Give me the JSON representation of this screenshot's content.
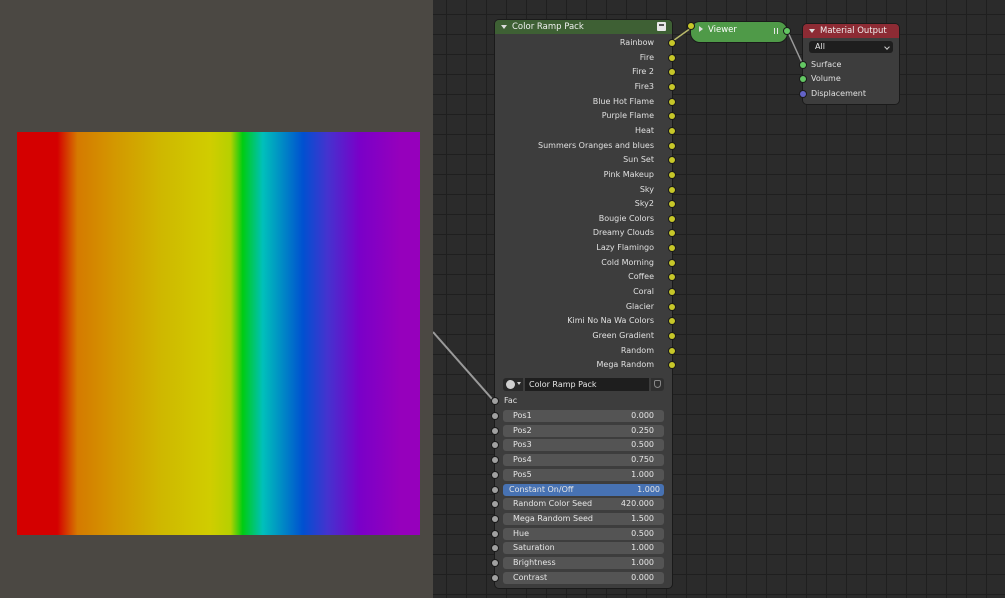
{
  "group_node": {
    "title": "Color Ramp Pack",
    "outputs": [
      "Rainbow",
      "Fire",
      "Fire 2",
      "Fire3",
      "Blue Hot Flame",
      "Purple Flame",
      "Heat",
      "Summers Oranges and blues",
      "Sun Set",
      "Pink Makeup",
      "Sky",
      "Sky2",
      "Bougie Colors",
      "Dreamy Clouds",
      "Lazy Flamingo",
      "Cold Morning",
      "Coffee",
      "Coral",
      "Glacier",
      "Kimi No Na Wa Colors",
      "Green Gradient",
      "Random",
      "Mega Random"
    ],
    "datablock_name": "Color Ramp Pack",
    "fac_label": "Fac",
    "inputs": [
      {
        "label": "Pos1",
        "value": "0.000"
      },
      {
        "label": "Pos2",
        "value": "0.250"
      },
      {
        "label": "Pos3",
        "value": "0.500"
      },
      {
        "label": "Pos4",
        "value": "0.750"
      },
      {
        "label": "Pos5",
        "value": "1.000"
      },
      {
        "label": "Constant On/Off",
        "value": "1.000"
      },
      {
        "label": "Random Color Seed",
        "value": "420.000"
      },
      {
        "label": "Mega Random Seed",
        "value": "1.500"
      },
      {
        "label": "Hue",
        "value": "0.500"
      },
      {
        "label": "Saturation",
        "value": "1.000"
      },
      {
        "label": "Brightness",
        "value": "1.000"
      },
      {
        "label": "Contrast",
        "value": "0.000"
      }
    ]
  },
  "viewer_node": {
    "title": "Viewer"
  },
  "output_node": {
    "title": "Material Output",
    "target": "All",
    "inputs": [
      "Surface",
      "Volume",
      "Displacement"
    ]
  },
  "colors": {
    "group_header": "#3e6034",
    "viewer": "#4f9a48",
    "output_header": "#8d2b34",
    "active_field": "#4772b3",
    "color_socket": "#c7c729",
    "value_socket": "#a1a1a1",
    "shader_socket": "#63c763",
    "vector_socket": "#6363c7"
  },
  "icons": [
    "pack-icon",
    "world-icon",
    "dropdown-chevron-icon",
    "shield-icon",
    "collapse-triangle-icon",
    "expand-triangle-icon",
    "viewer-grip-icon"
  ]
}
